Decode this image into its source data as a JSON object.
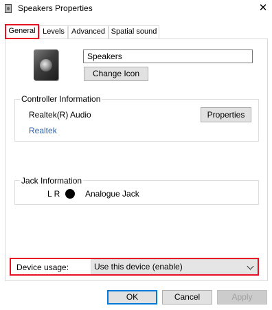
{
  "window": {
    "title": "Speakers Properties"
  },
  "tabs": [
    {
      "label": "General",
      "active": true
    },
    {
      "label": "Levels"
    },
    {
      "label": "Advanced"
    },
    {
      "label": "Spatial sound"
    }
  ],
  "general": {
    "device_name": "Speakers",
    "change_icon_label": "Change Icon",
    "controller": {
      "heading": "Controller Information",
      "name": "Realtek(R) Audio",
      "link": "Realtek",
      "properties_label": "Properties"
    },
    "jack": {
      "heading": "Jack Information",
      "channels": "L R",
      "type": "Analogue Jack"
    },
    "device_usage": {
      "label": "Device usage:",
      "value": "Use this device (enable)"
    }
  },
  "buttons": {
    "ok": "OK",
    "cancel": "Cancel",
    "apply": "Apply"
  },
  "colors": {
    "highlight": "#e81123",
    "link": "#2a5ca8",
    "focus": "#0078d7"
  }
}
